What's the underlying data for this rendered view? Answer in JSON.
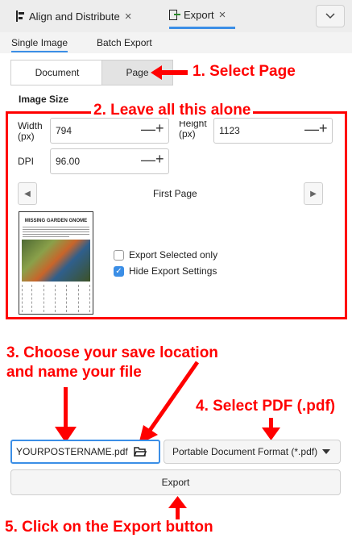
{
  "tabs": {
    "align": {
      "label": "Align and Distribute",
      "close": "×"
    },
    "export": {
      "label": "Export",
      "close": "×"
    }
  },
  "subtabs": {
    "single": "Single Image",
    "batch": "Batch Export"
  },
  "segments": {
    "document": "Document",
    "page": "Page"
  },
  "image_size": {
    "heading": "Image Size",
    "width_label_1": "Width",
    "width_label_2": "(px)",
    "width_value": "794",
    "height_label_1": "Height",
    "height_label_2": "(px)",
    "height_value": "1123",
    "dpi_label": "DPI",
    "dpi_value": "96.00",
    "plus": "+",
    "minus": "—"
  },
  "page_nav": {
    "label": "First Page"
  },
  "preview": {
    "title": "MISSING GARDEN GNOME"
  },
  "options": {
    "export_selected": "Export Selected only",
    "hide_settings": "Hide Export Settings",
    "hide_settings_checked": true
  },
  "filename": {
    "value": "YOURPOSTERNAME.pdf"
  },
  "format": {
    "value": "Portable Document Format (*.pdf)"
  },
  "export_button": "Export",
  "annotations": {
    "a1": "1. Select Page",
    "a2": "2. Leave all this alone",
    "a3_line1": "3. Choose your save location",
    "a3_line2": "and name your file",
    "a4": "4. Select PDF (.pdf)",
    "a5": "5. Click on the Export button"
  },
  "colors": {
    "annotation": "#ff0000",
    "accent": "#3b8ee6"
  }
}
